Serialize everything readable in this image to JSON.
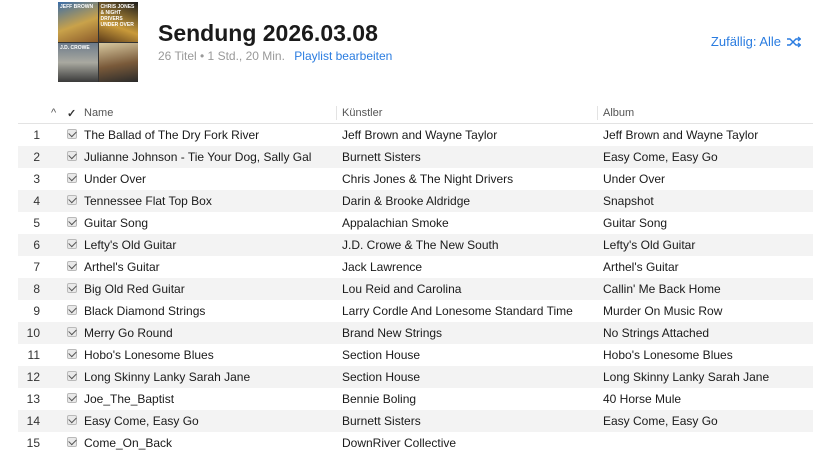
{
  "playlist": {
    "title": "Sendung 2026.03.08",
    "meta": "26 Titel • 1 Std., 20 Min.",
    "edit_label": "Playlist bearbeiten",
    "shuffle_label": "Zufällig: Alle",
    "artwork": [
      "Jeff Brown",
      "Chris Jones & Night Drivers Under Over",
      "J.D. Crowe",
      ""
    ]
  },
  "columns": {
    "sort": "^",
    "check": "✓",
    "name": "Name",
    "artist": "Künstler",
    "album": "Album"
  },
  "tracks": [
    {
      "num": "1",
      "name": "The Ballad of The Dry Fork River",
      "artist": "Jeff Brown and Wayne Taylor",
      "album": "Jeff Brown and Wayne Taylor"
    },
    {
      "num": "2",
      "name": "Julianne Johnson - Tie Your Dog, Sally Gal",
      "artist": "Burnett Sisters",
      "album": "Easy Come, Easy Go"
    },
    {
      "num": "3",
      "name": "Under Over",
      "artist": "Chris Jones & The Night Drivers",
      "album": "Under Over"
    },
    {
      "num": "4",
      "name": "Tennessee Flat Top Box",
      "artist": "Darin & Brooke Aldridge",
      "album": "Snapshot"
    },
    {
      "num": "5",
      "name": "Guitar Song",
      "artist": "Appalachian Smoke",
      "album": "Guitar Song"
    },
    {
      "num": "6",
      "name": "Lefty's Old Guitar",
      "artist": "J.D. Crowe & The New South",
      "album": "Lefty's Old Guitar"
    },
    {
      "num": "7",
      "name": "Arthel's Guitar",
      "artist": "Jack Lawrence",
      "album": "Arthel's Guitar"
    },
    {
      "num": "8",
      "name": "Big Old Red Guitar",
      "artist": "Lou Reid and Carolina",
      "album": "Callin' Me Back Home"
    },
    {
      "num": "9",
      "name": "Black Diamond Strings",
      "artist": "Larry Cordle And Lonesome Standard Time",
      "album": "Murder On Music Row"
    },
    {
      "num": "10",
      "name": "Merry Go Round",
      "artist": "Brand New Strings",
      "album": "No Strings Attached"
    },
    {
      "num": "11",
      "name": "Hobo's Lonesome Blues",
      "artist": "Section House",
      "album": "Hobo's Lonesome Blues"
    },
    {
      "num": "12",
      "name": "Long Skinny Lanky Sarah Jane",
      "artist": "Section House",
      "album": "Long Skinny Lanky Sarah Jane"
    },
    {
      "num": "13",
      "name": "Joe_The_Baptist",
      "artist": "Bennie Boling",
      "album": "40 Horse Mule"
    },
    {
      "num": "14",
      "name": "Easy Come, Easy Go",
      "artist": "Burnett Sisters",
      "album": "Easy Come, Easy Go"
    },
    {
      "num": "15",
      "name": "Come_On_Back",
      "artist": "DownRiver Collective",
      "album": ""
    }
  ],
  "colors": {
    "accent": "#2a7ce0",
    "row_alt": "#f3f3f3"
  }
}
